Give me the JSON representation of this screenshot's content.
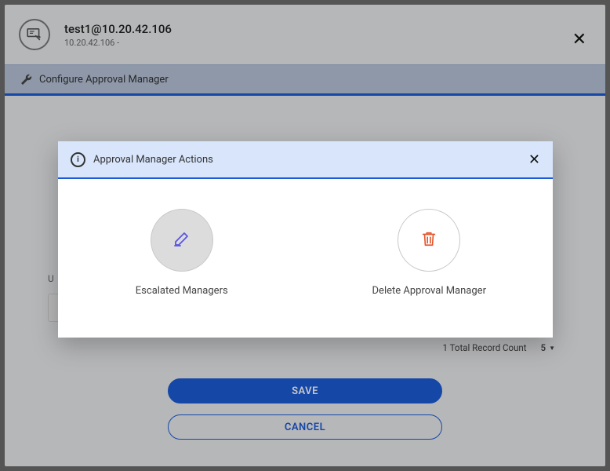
{
  "header": {
    "title": "test1@10.20.42.106",
    "subtitle": "10.20.42.106   -"
  },
  "config_bar": {
    "title": "Configure Approval Manager"
  },
  "form": {
    "label": "U",
    "value": ""
  },
  "records": {
    "count_text": "1 Total Record Count",
    "page_size": "5"
  },
  "buttons": {
    "save": "SAVE",
    "cancel": "CANCEL"
  },
  "modal": {
    "title": "Approval Manager Actions",
    "actions": {
      "escalated": "Escalated Managers",
      "delete": "Delete Approval Manager"
    }
  }
}
